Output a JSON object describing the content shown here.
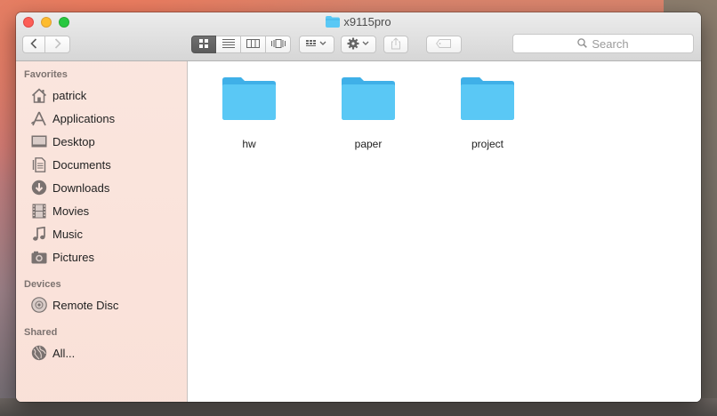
{
  "window": {
    "title": "x9115pro"
  },
  "toolbar": {
    "back_icon": "chevron-left-icon",
    "forward_icon": "chevron-right-icon",
    "view_modes": [
      "icon-view",
      "list-view",
      "column-view",
      "cover-flow-view"
    ],
    "active_view": "icon-view",
    "search_placeholder": "Search"
  },
  "sidebar": {
    "favorites_header": "Favorites",
    "favorites": [
      {
        "label": "patrick",
        "icon": "home-icon"
      },
      {
        "label": "Applications",
        "icon": "applications-icon"
      },
      {
        "label": "Desktop",
        "icon": "desktop-icon"
      },
      {
        "label": "Documents",
        "icon": "documents-icon"
      },
      {
        "label": "Downloads",
        "icon": "downloads-icon"
      },
      {
        "label": "Movies",
        "icon": "movies-icon"
      },
      {
        "label": "Music",
        "icon": "music-icon"
      },
      {
        "label": "Pictures",
        "icon": "pictures-icon"
      }
    ],
    "devices_header": "Devices",
    "devices": [
      {
        "label": "Remote Disc",
        "icon": "disc-icon"
      }
    ],
    "shared_header": "Shared",
    "shared": [
      {
        "label": "All...",
        "icon": "network-icon"
      }
    ]
  },
  "content": {
    "folders": [
      {
        "name": "hw"
      },
      {
        "name": "paper"
      },
      {
        "name": "project"
      }
    ]
  },
  "colors": {
    "folder": "#5ac8f5",
    "accent_red": "#fc5f57",
    "accent_yellow": "#fdbc2e",
    "accent_green": "#28c840"
  }
}
